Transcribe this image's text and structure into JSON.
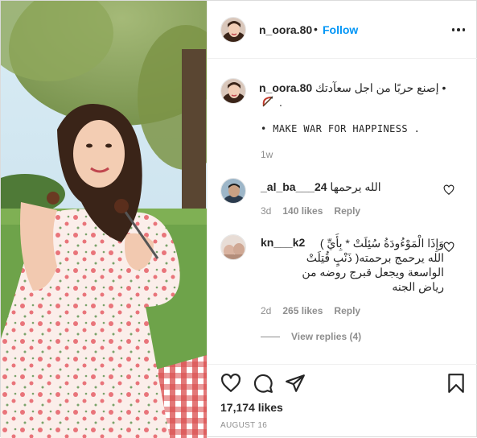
{
  "post": {
    "username": "n_oora.80",
    "dot": "•",
    "follow_label": "Follow",
    "more_icon": "more-horizontal-icon"
  },
  "caption": {
    "username": "n_oora.80",
    "arabic_text": "• إصنع حربًا من اجل سعآدتك",
    "emoji_icon": "bow-and-arrow-emoji",
    "period": ".",
    "english_text": "• MAKE WAR FOR HAPPINESS .",
    "time": "1w"
  },
  "comments": [
    {
      "username": "_al_ba___24",
      "text": "الله يرحمها",
      "time": "3d",
      "likes": "140 likes",
      "reply_label": "Reply"
    },
    {
      "username": "kn___k2",
      "lines": [
        "وَإِذَا الْمَوْءُودَةُ سُئِلَتْ * بِأَيِّ )",
        "الله يرحمج برحمته( ذَنْبٍ قُتِلَتْ",
        "الواسعة ويجعل قبرج روضه من",
        "رياض الجنه"
      ],
      "time": "2d",
      "likes": "265 likes",
      "reply_label": "Reply",
      "view_replies": "View replies (4)"
    }
  ],
  "actions": {
    "likes_count": "17,174 likes",
    "date": "AUGUST 16"
  },
  "colors": {
    "link_blue": "#0095f6",
    "text": "#262626",
    "muted": "#8e8e8e"
  }
}
